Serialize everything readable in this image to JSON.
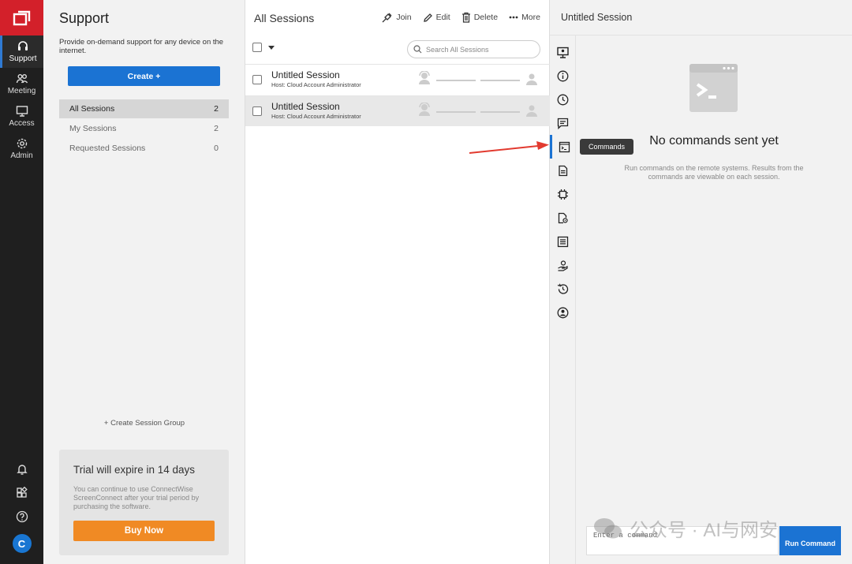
{
  "nav": {
    "items": [
      {
        "label": "Support",
        "icon": "headset-icon"
      },
      {
        "label": "Meeting",
        "icon": "people-icon"
      },
      {
        "label": "Access",
        "icon": "monitor-icon"
      },
      {
        "label": "Admin",
        "icon": "gear-icon"
      }
    ],
    "avatar_letter": "C"
  },
  "support": {
    "title": "Support",
    "description": "Provide on-demand support for any device on the internet.",
    "create_label": "Create +",
    "groups": [
      {
        "label": "All Sessions",
        "count": "2"
      },
      {
        "label": "My Sessions",
        "count": "2"
      },
      {
        "label": "Requested Sessions",
        "count": "0"
      }
    ],
    "create_group_label": "+ Create Session Group",
    "trial": {
      "title": "Trial will expire in 14 days",
      "text": "You can continue to use ConnectWise ScreenConnect after your trial period by purchasing the software.",
      "buy_label": "Buy Now"
    }
  },
  "sessions": {
    "title": "All Sessions",
    "toolbar": {
      "join": "Join",
      "edit": "Edit",
      "delete": "Delete",
      "more": "More"
    },
    "search_placeholder": "Search All Sessions",
    "rows": [
      {
        "name": "Untitled Session",
        "host": "Host: Cloud Account Administrator"
      },
      {
        "name": "Untitled Session",
        "host": "Host: Cloud Account Administrator"
      }
    ]
  },
  "detail": {
    "title": "Untitled Session",
    "tooltip": "Commands",
    "empty_title": "No commands sent yet",
    "empty_desc": "Run commands on the remote systems. Results from the commands are viewable on each session.",
    "command_placeholder": "Enter a command",
    "run_label": "Run Command"
  },
  "watermark": "公众号 · AI与网安",
  "colors": {
    "brand_red": "#d3202a",
    "accent_blue": "#1b73d3",
    "buy_orange": "#f08a24"
  }
}
